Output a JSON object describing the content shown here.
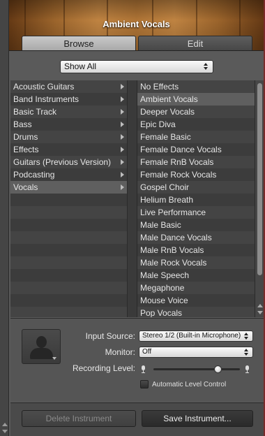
{
  "header": {
    "title": "Ambient Vocals"
  },
  "tabs": [
    {
      "label": "Browse",
      "active": true
    },
    {
      "label": "Edit",
      "active": false
    }
  ],
  "filter": {
    "selected": "Show All"
  },
  "categories": [
    {
      "label": "Acoustic Guitars",
      "selected": false
    },
    {
      "label": "Band Instruments",
      "selected": false
    },
    {
      "label": "Basic Track",
      "selected": false
    },
    {
      "label": "Bass",
      "selected": false
    },
    {
      "label": "Drums",
      "selected": false
    },
    {
      "label": "Effects",
      "selected": false
    },
    {
      "label": "Guitars (Previous Version)",
      "selected": false
    },
    {
      "label": "Podcasting",
      "selected": false
    },
    {
      "label": "Vocals",
      "selected": true
    }
  ],
  "presets": [
    {
      "label": "No Effects",
      "selected": false
    },
    {
      "label": "Ambient Vocals",
      "selected": true
    },
    {
      "label": "Deeper Vocals",
      "selected": false
    },
    {
      "label": "Epic Diva",
      "selected": false
    },
    {
      "label": "Female Basic",
      "selected": false
    },
    {
      "label": "Female Dance Vocals",
      "selected": false
    },
    {
      "label": "Female RnB Vocals",
      "selected": false
    },
    {
      "label": "Female Rock Vocals",
      "selected": false
    },
    {
      "label": "Gospel Choir",
      "selected": false
    },
    {
      "label": "Helium Breath",
      "selected": false
    },
    {
      "label": "Live Performance",
      "selected": false
    },
    {
      "label": "Male Basic",
      "selected": false
    },
    {
      "label": "Male Dance Vocals",
      "selected": false
    },
    {
      "label": "Male RnB Vocals",
      "selected": false
    },
    {
      "label": "Male Rock Vocals",
      "selected": false
    },
    {
      "label": "Male Speech",
      "selected": false
    },
    {
      "label": "Megaphone",
      "selected": false
    },
    {
      "label": "Mouse Voice",
      "selected": false
    },
    {
      "label": "Pop Vocals",
      "selected": false
    }
  ],
  "settings": {
    "input_source_label": "Input Source:",
    "input_source_value": "Stereo 1/2 (Built-in Microphone)",
    "monitor_label": "Monitor:",
    "monitor_value": "Off",
    "recording_level_label": "Recording Level:",
    "recording_level": 0.75,
    "auto_level_label": "Automatic Level Control",
    "auto_level_checked": false
  },
  "buttons": {
    "delete_label": "Delete Instrument",
    "save_label": "Save Instrument..."
  },
  "icons": {
    "avatar": "person-silhouette-icon",
    "mic_low": "microphone-icon",
    "mic_high": "microphone-icon",
    "category_arrow": "chevron-right-icon"
  }
}
